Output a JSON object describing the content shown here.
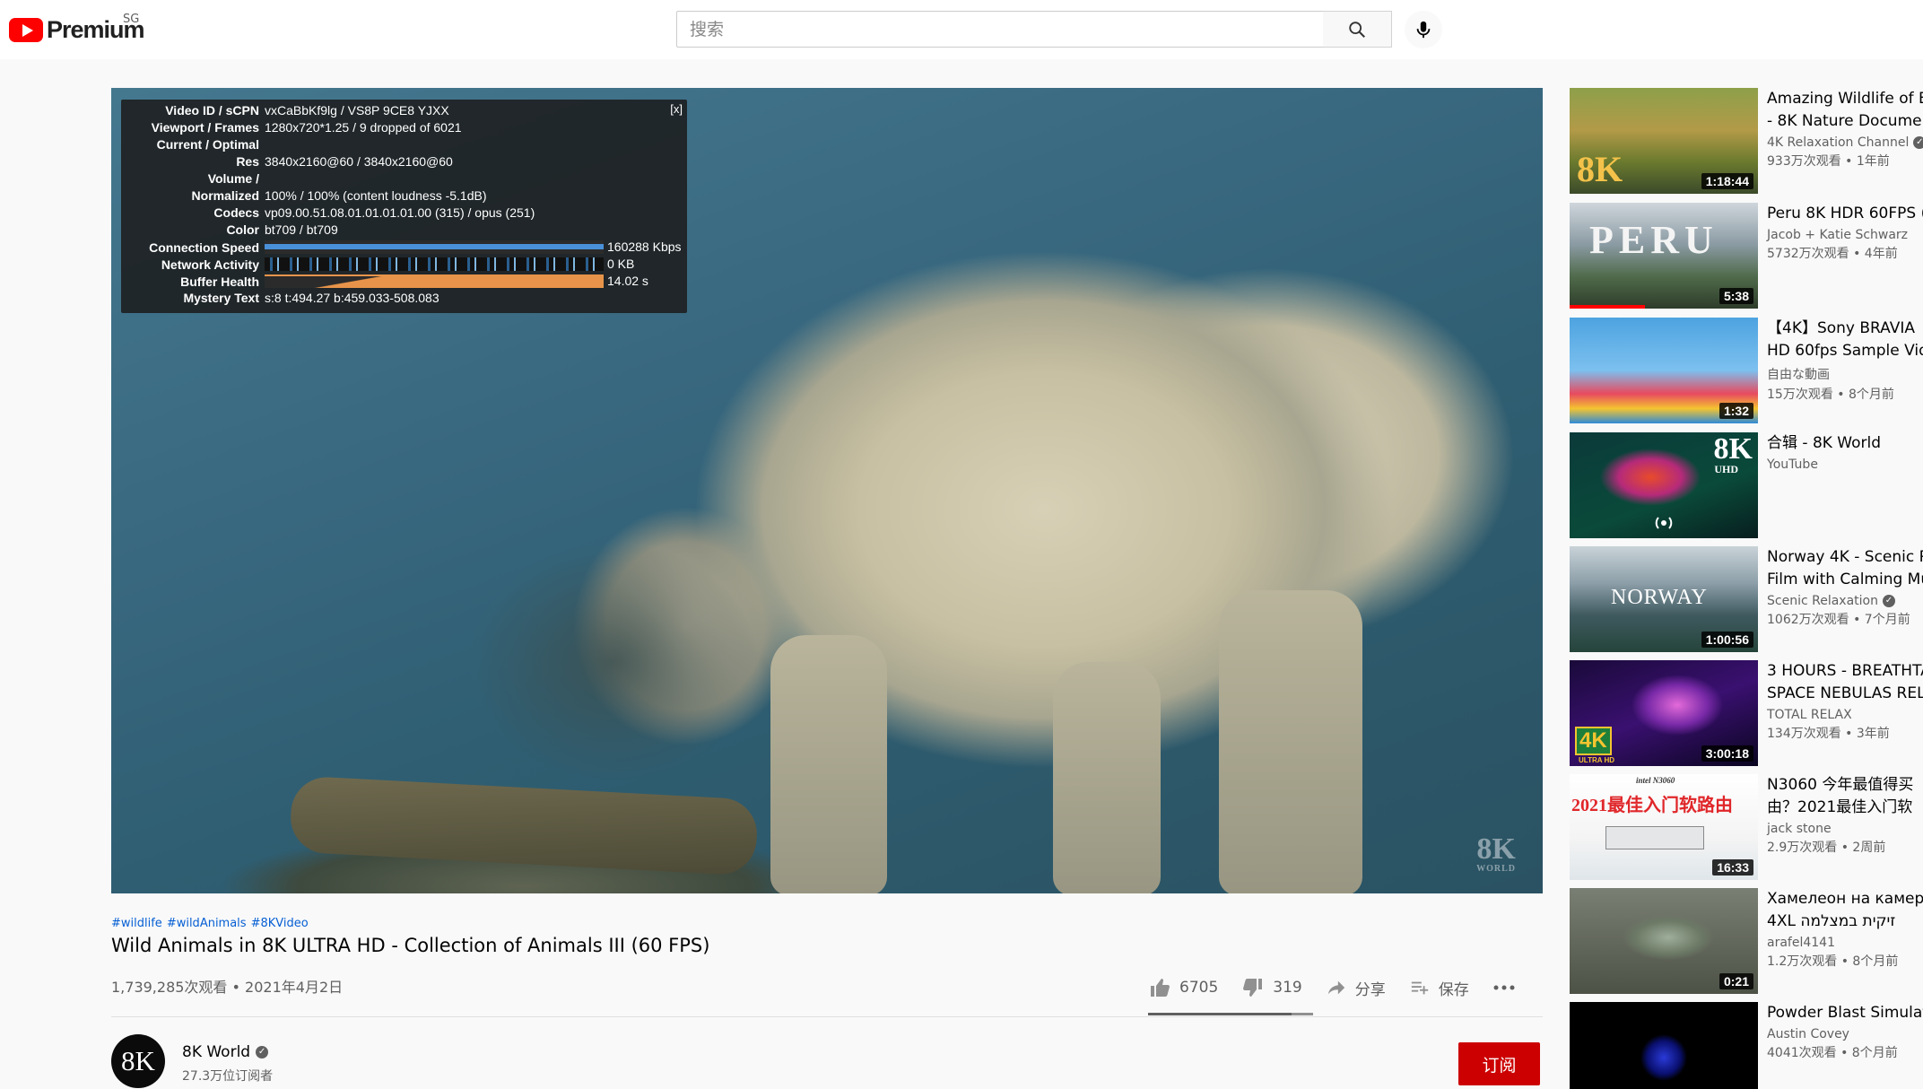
{
  "header": {
    "logo_text": "Premium",
    "country_code": "SG",
    "search_placeholder": "搜索",
    "search_icon": "search-icon",
    "mic_icon": "microphone-icon"
  },
  "player": {
    "watermark": "8K",
    "watermark_sub": "WORLD",
    "stats": {
      "close_label": "[x]",
      "rows": [
        {
          "label": "Video ID / sCPN",
          "value": "vxCaBbKf9lg / VS8P 9CE8 YJXX"
        },
        {
          "label": "Viewport / Frames",
          "value": "1280x720*1.25 / 9 dropped of 6021"
        },
        {
          "label": "Current / Optimal",
          "value": ""
        },
        {
          "label": "Res",
          "value": "3840x2160@60 / 3840x2160@60"
        },
        {
          "label": "Volume /",
          "value": ""
        },
        {
          "label": "Normalized",
          "value": "100% / 100% (content loudness -5.1dB)"
        },
        {
          "label": "Codecs",
          "value": "vp09.00.51.08.01.01.01.01.00 (315) / opus (251)"
        },
        {
          "label": "Color",
          "value": "bt709 / bt709"
        }
      ],
      "graphs": [
        {
          "label": "Connection Speed",
          "value": "160288 Kbps"
        },
        {
          "label": "Network Activity",
          "value": "0 KB"
        },
        {
          "label": "Buffer Health",
          "value": "14.02 s"
        }
      ],
      "mystery": {
        "label": "Mystery Text",
        "value": "s:8 t:494.27 b:459.033-508.083"
      }
    }
  },
  "video": {
    "hashtags": [
      "#wildlife",
      "#wildAnimals",
      "#8KVideo"
    ],
    "title": "Wild Animals in 8K ULTRA HD - Collection of Animals III (60 FPS)",
    "meta": "1,739,285次观看 • 2021年4月2日",
    "likes": "6705",
    "dislikes": "319",
    "like_ratio": 0.87,
    "share_label": "分享",
    "save_label": "保存",
    "more_icon": "more-options-icon"
  },
  "owner": {
    "avatar_text": "8K",
    "name": "8K World",
    "subscribers": "27.3万位订阅者",
    "subscribe_label": "订阅"
  },
  "sidebar": {
    "items": [
      {
        "title1": "Amazing Wildlife of B",
        "title2": "- 8K Nature Documen",
        "channel": "4K Relaxation Channel",
        "verified": true,
        "views": "933万次观看 • 1年前",
        "duration": "1:18:44",
        "thumb_text": "8K"
      },
      {
        "title1": "Peru 8K HDR 60FPS (",
        "title2": "",
        "channel": "Jacob + Katie Schwarz",
        "verified": false,
        "views": "5732万次观看 • 4年前",
        "duration": "5:38",
        "thumb_text": "PERU",
        "progress": 0.4
      },
      {
        "title1": "【4K】Sony BRAVIA",
        "title2": "HD 60fps Sample Vid",
        "channel": "自由な動画",
        "verified": false,
        "views": "15万次观看 • 8个月前",
        "duration": "1:32",
        "thumb_text": ""
      },
      {
        "title1": "合辑 - 8K World",
        "title2": "",
        "channel": "YouTube",
        "verified": false,
        "views": "",
        "duration": "",
        "thumb_text": "8K",
        "thumb_sub": "UHD",
        "live_icon": "broadcast-icon"
      },
      {
        "title1": "Norway 4K - Scenic R",
        "title2": "Film with Calming Mu",
        "channel": "Scenic Relaxation",
        "verified": true,
        "views": "1062万次观看 • 7个月前",
        "duration": "1:00:56",
        "thumb_text": "NORWAY"
      },
      {
        "title1": "3 HOURS - BREATHTA",
        "title2": "SPACE NEBULAS REL",
        "channel": "TOTAL RELAX",
        "verified": false,
        "views": "134万次观看 • 3年前",
        "duration": "3:00:18",
        "thumb_text": "4K",
        "thumb_sub": "ULTRA HD"
      },
      {
        "title1": "N3060 今年最值得买",
        "title2": "由？2021最佳入门软",
        "channel": "jack stone",
        "verified": false,
        "views": "2.9万次观看 • 2周前",
        "duration": "16:33",
        "thumb_text": "2021最佳入门软路由",
        "thumb_sub": "intel N3060"
      },
      {
        "title1": "Хамелеон на камеру",
        "title2": "4XL זיקית במצלמה",
        "channel": "arafel4141",
        "verified": false,
        "views": "1.2万次观看 • 8个月前",
        "duration": "0:21",
        "thumb_text": ""
      },
      {
        "title1": "Powder Blast Simulat",
        "title2": "",
        "channel": "Austin Covey",
        "verified": false,
        "views": "4041次观看 • 8个月前",
        "duration": "",
        "thumb_text": ""
      }
    ]
  }
}
